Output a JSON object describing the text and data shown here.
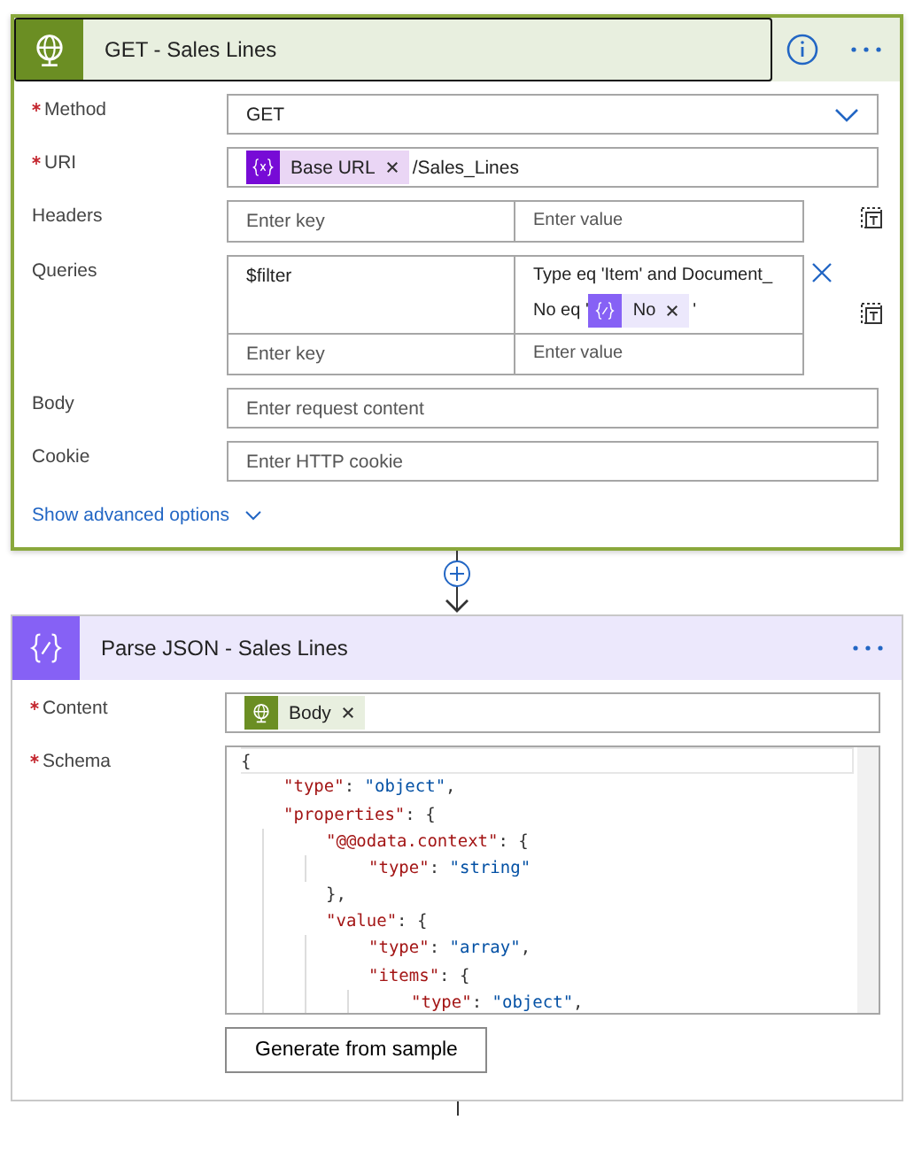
{
  "http_action": {
    "title": "GET - Sales Lines",
    "fields": [
      {
        "kind": "dropdown",
        "label": "Method",
        "required": true,
        "value": "GET"
      },
      {
        "kind": "token_input",
        "label": "URI",
        "required": true,
        "content": [
          {
            "kind": "variable",
            "text": "Base URL"
          },
          {
            "kind": "text",
            "text": "/Sales_Lines"
          }
        ]
      },
      {
        "kind": "key_value",
        "label": "Headers",
        "required": false,
        "rows": [
          {
            "key_placeholder": "Enter key",
            "value_placeholder": "Enter value"
          }
        ]
      },
      {
        "kind": "key_value",
        "label": "Queries",
        "required": false,
        "rows": [
          {
            "key": "$filter",
            "value": [
              {
                "kind": "text",
                "text": "Type eq 'Item' and Document_"
              },
              {
                "kind": "text",
                "text": "No eq '"
              },
              {
                "kind": "expression",
                "text": "No"
              },
              {
                "kind": "text",
                "text": "'"
              }
            ]
          },
          {
            "key_placeholder": "Enter key",
            "value_placeholder": "Enter value"
          }
        ]
      },
      {
        "kind": "text_input",
        "label": "Body",
        "required": false,
        "placeholder": "Enter request content"
      },
      {
        "kind": "text_input",
        "label": "Cookie",
        "required": false,
        "placeholder": "Enter HTTP cookie"
      }
    ],
    "advanced_link": "Show advanced options"
  },
  "parse_action": {
    "title": "Parse JSON - Sales Lines",
    "fields": [
      {
        "kind": "token_input",
        "label": "Content",
        "required": true,
        "content": [
          {
            "kind": "http",
            "text": "Body"
          }
        ]
      },
      {
        "kind": "code",
        "label": "Schema",
        "required": true,
        "lines": [
          {
            "tokens": [
              {
                "kind": "punct",
                "text": "{"
              }
            ],
            "children": [
              {
                "tokens": [
                  {
                    "kind": "key",
                    "text": "\"type\""
                  },
                  {
                    "kind": "punct",
                    "text": ": "
                  },
                  {
                    "kind": "string",
                    "text": "\"object\""
                  },
                  {
                    "kind": "punct",
                    "text": ","
                  }
                ]
              },
              {
                "tokens": [
                  {
                    "kind": "key",
                    "text": "\"properties\""
                  },
                  {
                    "kind": "punct",
                    "text": ": {"
                  }
                ],
                "children": [
                  {
                    "tokens": [
                      {
                        "kind": "key",
                        "text": "\"@@odata.context\""
                      },
                      {
                        "kind": "punct",
                        "text": ": {"
                      }
                    ],
                    "children": [
                      {
                        "tokens": [
                          {
                            "kind": "key",
                            "text": "\"type\""
                          },
                          {
                            "kind": "punct",
                            "text": ": "
                          },
                          {
                            "kind": "string",
                            "text": "\"string\""
                          }
                        ]
                      }
                    ]
                  },
                  {
                    "tokens": [
                      {
                        "kind": "punct",
                        "text": "},"
                      }
                    ]
                  },
                  {
                    "tokens": [
                      {
                        "kind": "key",
                        "text": "\"value\""
                      },
                      {
                        "kind": "punct",
                        "text": ": {"
                      }
                    ],
                    "children": [
                      {
                        "tokens": [
                          {
                            "kind": "key",
                            "text": "\"type\""
                          },
                          {
                            "kind": "punct",
                            "text": ": "
                          },
                          {
                            "kind": "string",
                            "text": "\"array\""
                          },
                          {
                            "kind": "punct",
                            "text": ","
                          }
                        ]
                      },
                      {
                        "tokens": [
                          {
                            "kind": "key",
                            "text": "\"items\""
                          },
                          {
                            "kind": "punct",
                            "text": ": {"
                          }
                        ],
                        "children": [
                          {
                            "tokens": [
                              {
                                "kind": "key",
                                "text": "\"type\""
                              },
                              {
                                "kind": "punct",
                                "text": ": "
                              },
                              {
                                "kind": "string",
                                "text": "\"object\""
                              },
                              {
                                "kind": "punct",
                                "text": ","
                              }
                            ]
                          }
                        ]
                      }
                    ]
                  }
                ]
              }
            ]
          }
        ]
      }
    ],
    "button": "Generate from sample"
  }
}
